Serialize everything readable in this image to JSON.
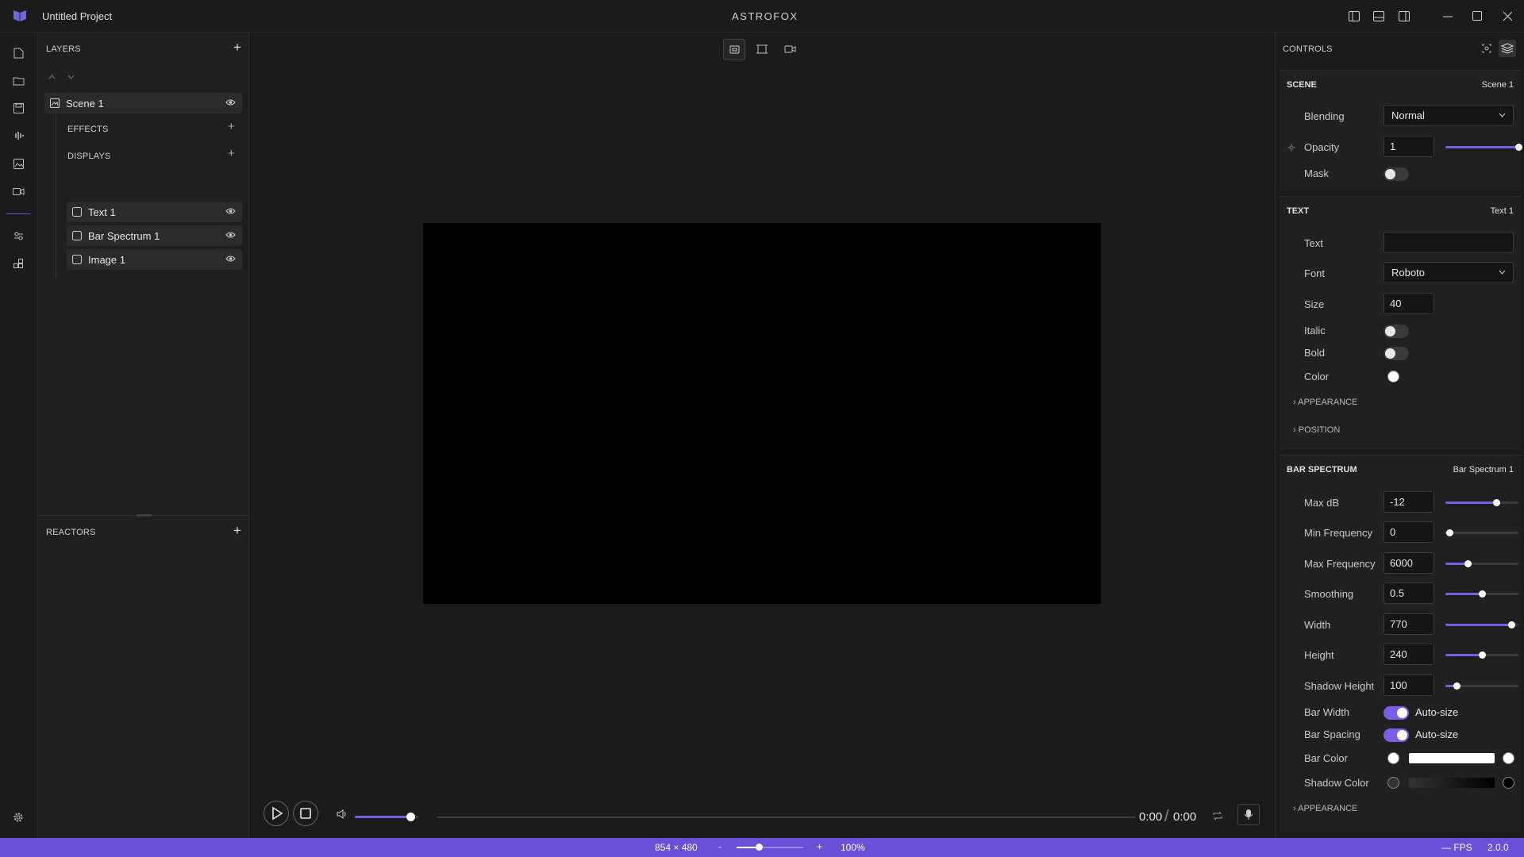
{
  "title_bar": {
    "project": "Untitled Project",
    "app": "ASTROFOX"
  },
  "layers_panel": {
    "title": "LAYERS",
    "scene": "Scene 1",
    "effects": "EFFECTS",
    "displays": "DISPLAYS",
    "display_items": [
      "Text 1",
      "Bar Spectrum 1",
      "Image 1"
    ],
    "reactors": "REACTORS"
  },
  "transport": {
    "time_current": "0:00",
    "time_separator": "/",
    "time_total": "0:00",
    "volume_fraction": 0.87,
    "progress_fraction": 0
  },
  "status_bar": {
    "resolution": "854 × 480",
    "minus": "-",
    "plus": "+",
    "zoom": "100%",
    "zoom_fraction": 0.33,
    "fps": "— FPS",
    "version": "2.0.0"
  },
  "controls": {
    "title": "CONTROLS",
    "scene": {
      "title": "SCENE",
      "name": "Scene 1",
      "blending_label": "Blending",
      "blending": "Normal",
      "opacity_label": "Opacity",
      "opacity": "1",
      "opacity_fraction": 1.0,
      "mask_label": "Mask",
      "mask": false
    },
    "text": {
      "title": "TEXT",
      "name": "Text 1",
      "text_label": "Text",
      "text": "",
      "font_label": "Font",
      "font": "Roboto",
      "size_label": "Size",
      "size": "40",
      "italic_label": "Italic",
      "italic": false,
      "bold_label": "Bold",
      "bold": false,
      "color_label": "Color",
      "color": "#ffffff",
      "appearance": "APPEARANCE",
      "position": "POSITION"
    },
    "bar_spectrum": {
      "title": "BAR SPECTRUM",
      "name": "Bar Spectrum 1",
      "max_db_label": "Max dB",
      "max_db": "-12",
      "max_db_fraction": 0.7,
      "min_freq_label": "Min Frequency",
      "min_freq": "0",
      "min_freq_fraction": 0.05,
      "max_freq_label": "Max Frequency",
      "max_freq": "6000",
      "max_freq_fraction": 0.3,
      "smoothing_label": "Smoothing",
      "smoothing": "0.5",
      "smoothing_fraction": 0.5,
      "width_label": "Width",
      "width": "770",
      "width_fraction": 0.9,
      "height_label": "Height",
      "height": "240",
      "height_fraction": 0.5,
      "shadow_height_label": "Shadow Height",
      "shadow_height": "100",
      "shadow_height_fraction": 0.15,
      "bar_width_label": "Bar Width",
      "bar_width_toggle": "Auto-size",
      "bar_spacing_label": "Bar Spacing",
      "bar_spacing_toggle": "Auto-size",
      "bar_color_label": "Bar Color",
      "bar_color_start": "#ffffff",
      "bar_color_end": "#ffffff",
      "shadow_color_label": "Shadow Color",
      "shadow_color_start": "#333333",
      "shadow_color_end": "#000000",
      "appearance": "APPEARANCE"
    }
  },
  "colors": {
    "accent": "#7b5ce8",
    "status_bar": "#6b4fd8",
    "canvas": "#000000"
  }
}
